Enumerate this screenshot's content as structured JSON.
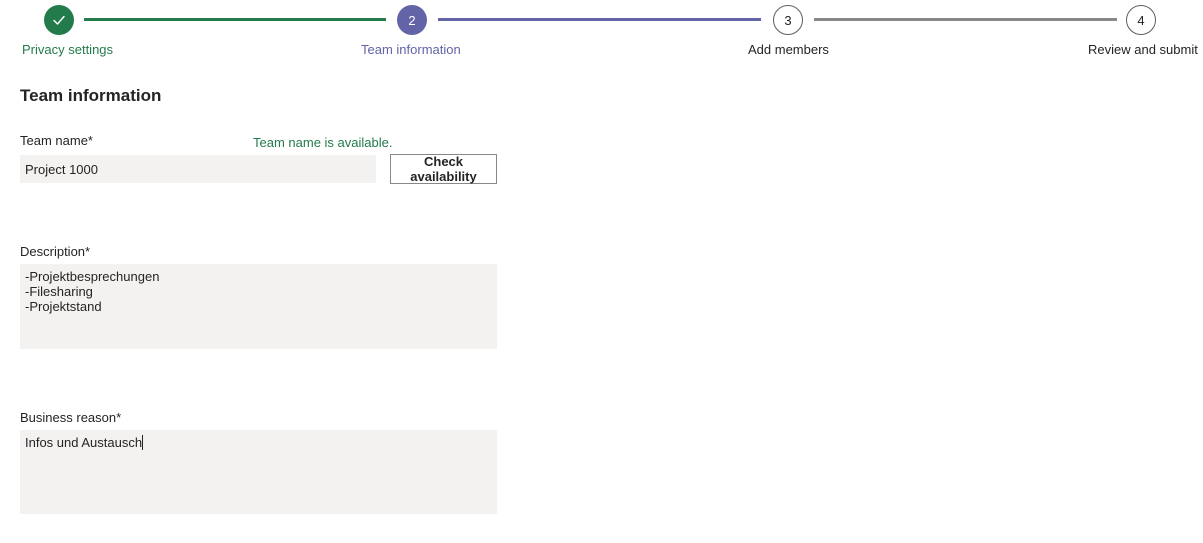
{
  "stepper": {
    "steps": [
      {
        "number": "1",
        "label": "Privacy settings",
        "state": "done"
      },
      {
        "number": "2",
        "label": "Team information",
        "state": "current"
      },
      {
        "number": "3",
        "label": "Add members",
        "state": "todo"
      },
      {
        "number": "4",
        "label": "Review and submit",
        "state": "todo"
      }
    ],
    "done_icon": "checkmark-icon",
    "colors": {
      "done": "#237b4b",
      "current": "#6264a7",
      "todo": "#8a8886"
    }
  },
  "form": {
    "title": "Team information",
    "team_name": {
      "label": "Team name*",
      "value": "Project 1000",
      "availability_message": "Team name is available.",
      "check_button": "Check availability"
    },
    "description": {
      "label": "Description*",
      "lines": [
        "-Projektbesprechungen",
        "-Filesharing",
        "-Projektstand"
      ]
    },
    "business_reason": {
      "label": "Business reason*",
      "value": "Infos und Austausch"
    }
  }
}
